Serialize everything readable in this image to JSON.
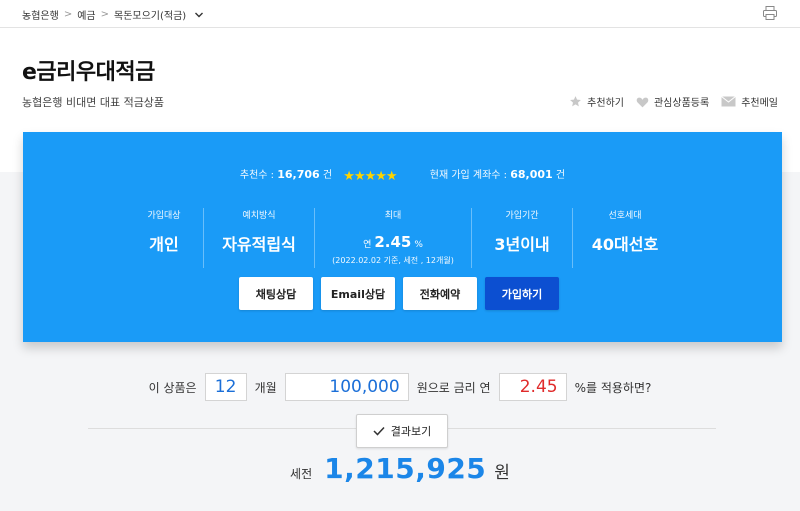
{
  "breadcrumb": {
    "items": [
      "농협은행",
      "예금",
      "목돈모으기(적금)"
    ]
  },
  "product": {
    "title": "e금리우대적금",
    "subtitle": "농협은행 비대면 대표 적금상품"
  },
  "actions": {
    "recommend": "추천하기",
    "favorite": "관심상품등록",
    "email": "추천메일"
  },
  "stats": {
    "recommend_label": "추천수 :",
    "recommend_count": "16,706",
    "recommend_unit": "건",
    "rating_stars": 5,
    "accounts_label": "현재 가입 계좌수 :",
    "accounts_count": "68,001",
    "accounts_unit": "건"
  },
  "info": {
    "target_label": "가입대상",
    "target_value": "개인",
    "method_label": "예치방식",
    "method_value": "자유적립식",
    "max_label": "최대",
    "max_prefix": "연",
    "max_rate": "2.45",
    "max_unit": "%",
    "max_note": "(2022.02.02 기준, 세전 , 12개월)",
    "period_label": "가입기간",
    "period_value": "3년이내",
    "gen_label": "선호세대",
    "gen_value": "40대선호"
  },
  "buttons": {
    "chat": "채팅상담",
    "email": "Email상담",
    "phone": "전화예약",
    "join": "가입하기"
  },
  "calculator": {
    "text1": "이 상품은",
    "months": "12",
    "text2": "개월",
    "amount": "100,000",
    "text3": "원으로  금리 연",
    "rate": "2.45",
    "text4": "%를 적용하면?",
    "result_button": "결과보기",
    "result_prefix": "세전",
    "result_amount": "1,215,925",
    "result_unit": "원"
  },
  "colors": {
    "card_blue": "#1a9bf7",
    "primary_button": "#0c4fd1",
    "star": "#ffd400",
    "result_blue": "#1b86e8",
    "rate_red": "#e02b2b"
  }
}
